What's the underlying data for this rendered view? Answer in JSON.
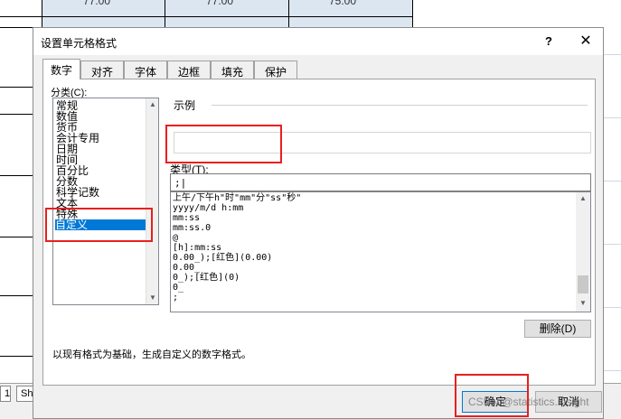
{
  "sheet": {
    "cells": [
      "77.00",
      "77.00",
      "75.00"
    ],
    "tab_label_1": "1",
    "tab_label_2": "She"
  },
  "dialog": {
    "title": "设置单元格格式",
    "help_symbol": "?",
    "close_symbol": "✕",
    "tabs": [
      {
        "label": "数字",
        "active": true
      },
      {
        "label": "对齐",
        "active": false
      },
      {
        "label": "字体",
        "active": false
      },
      {
        "label": "边框",
        "active": false
      },
      {
        "label": "填充",
        "active": false
      },
      {
        "label": "保护",
        "active": false
      }
    ],
    "category_label": "分类(C):",
    "categories": [
      "常规",
      "数值",
      "货币",
      "会计专用",
      "日期",
      "时间",
      "百分比",
      "分数",
      "科学记数",
      "文本",
      "特殊",
      "自定义"
    ],
    "selected_category": "自定义",
    "sample_label": "示例",
    "type_label": "类型(T):",
    "type_value": ";|",
    "format_list": [
      "上午/下午h\"时\"mm\"分\"ss\"秒\"",
      "yyyy/m/d h:mm",
      "mm:ss",
      "mm:ss.0",
      "@",
      "[h]:mm:ss",
      "0.00_);[红色](0.00)",
      "0.00_",
      "0_);[红色](0)",
      "0_",
      " ;"
    ],
    "delete_button": "删除(D)",
    "description": "以现有格式为基础，生成自定义的数字格式。",
    "ok_button": "确定",
    "cancel_button": "取消"
  },
  "watermark": "CSDN @statistics.insight",
  "colors": {
    "highlight": "#e8201e",
    "selection": "#0078d7",
    "dialog_bg": "#f0f0f0"
  }
}
